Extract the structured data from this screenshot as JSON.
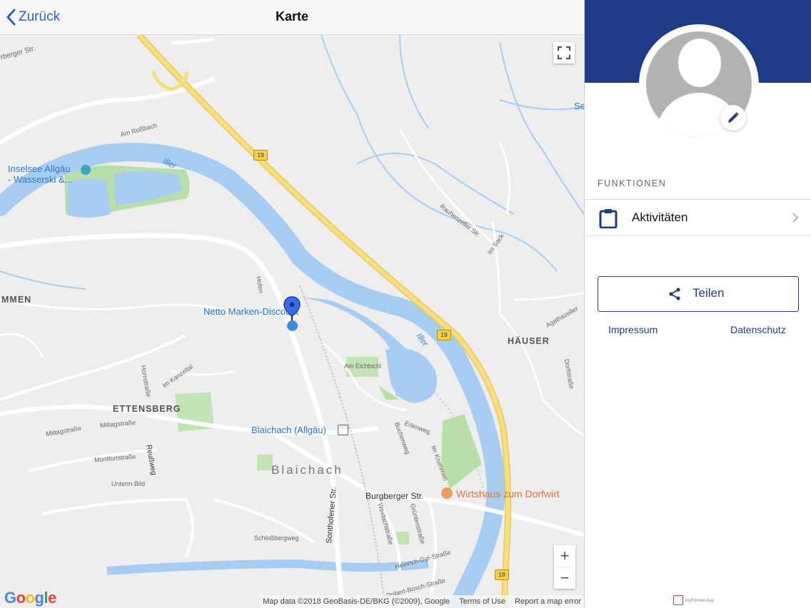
{
  "header": {
    "back_label": "Zurück",
    "title": "Karte"
  },
  "map": {
    "labels": {
      "inselsee": "Inselsee Allgäu",
      "wasserski": "- Wasserski &...",
      "iller_top": "Iller",
      "iller_bottom": "Iller",
      "netto": "Netto Marken-Discount",
      "blaichach_station": "Blaichach (Allgäu)",
      "wirtshaus": "Wirtshaus zum Dorfwirt",
      "ettensberg": "ETTENSBERG",
      "blaichach": "Blaichach",
      "hauser": "HÄUSER",
      "ommen": "MMEN",
      "burgberger_str": "Burgberger Str.",
      "sonthofener_str": "Sonthofener Str.",
      "burgberger_str_top": "rberger Str.",
      "am_rossbach": "Am Roßbach",
      "rauhenzeller": "Rauhenzeller Str.",
      "im_sack": "Im Sack",
      "agathazeller": "Agathazeller",
      "dorfstrasse": "Dorfstraße",
      "am_eichbichl": "Am Eichbichl",
      "hofen": "Hofen",
      "mittagstrasse": "Mittagstraße",
      "mittagstrasse2": "Mittagstraße",
      "montfortstrasse": "Montfortstraße",
      "reussweg": "Reußweg",
      "unterm_bild": "Unterm Bild",
      "schlossbergweg": "Schloßbergweg",
      "heinrich": "Heinrich-Gyr-Straße",
      "weidachstrasse": "Weidachstraße",
      "gruntenstrasse": "Grüntenstraße",
      "buchenweg": "Buchenweg",
      "erlenweg": "Erlenweg",
      "im_krummen": "Im Krummen",
      "hornstrasse": "Hornstraße",
      "im_kanzeltal": "Im Kanzeltal",
      "robert_bosch": "Robert-Bosch-Straße",
      "se": "Se"
    },
    "route_shield": "19",
    "attribution": {
      "data": "Map data ©2018 GeoBasis-DE/BKG (©2009), Google",
      "terms": "Terms of Use",
      "report": "Report a map error"
    },
    "google_logo": "Google",
    "zoom_in": "+",
    "zoom_out": "−"
  },
  "panel": {
    "section_label": "FUNKTIONEN",
    "menu": [
      {
        "label": "Aktivitäten",
        "icon": "clipboard-icon"
      }
    ],
    "share_label": "Teilen",
    "links": {
      "impressum": "Impressum",
      "datenschutz": "Datenschutz"
    },
    "app_logo": "myFirmenApp",
    "colors": {
      "banner": "#1f3a86",
      "accent": "#1f3a86"
    }
  }
}
